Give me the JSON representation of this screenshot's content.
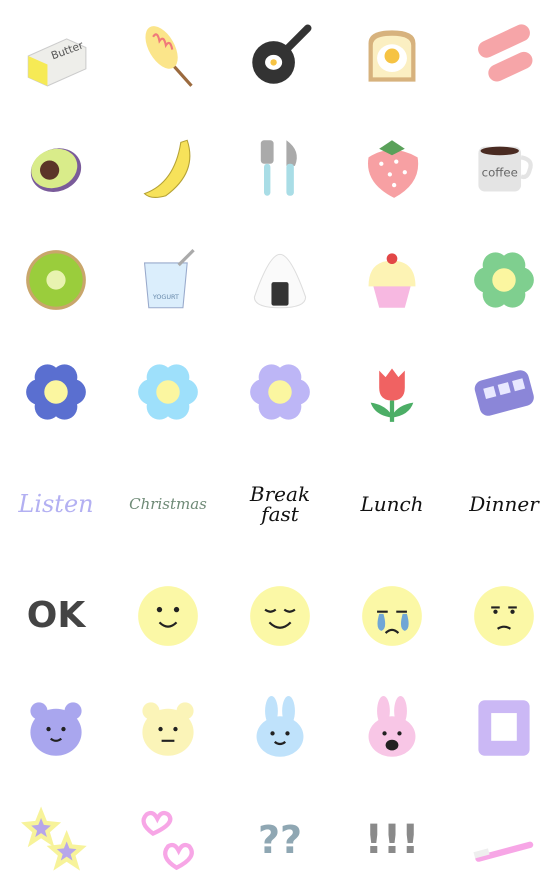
{
  "stickers": [
    {
      "name": "butter",
      "label": "Butter"
    },
    {
      "name": "corn-dog"
    },
    {
      "name": "frying-pan-egg"
    },
    {
      "name": "egg-toast"
    },
    {
      "name": "sausages"
    },
    {
      "name": "avocado"
    },
    {
      "name": "banana"
    },
    {
      "name": "fork-knife"
    },
    {
      "name": "strawberry"
    },
    {
      "name": "coffee-cup",
      "label": "coffee"
    },
    {
      "name": "kiwi"
    },
    {
      "name": "yogurt",
      "label": "YOGURT"
    },
    {
      "name": "onigiri"
    },
    {
      "name": "cupcake"
    },
    {
      "name": "green-flower",
      "color": "#7fcf8f"
    },
    {
      "name": "blue-flower",
      "color": "#5a6fd0"
    },
    {
      "name": "light-blue-flower",
      "color": "#9ee0fb"
    },
    {
      "name": "lavender-flower",
      "color": "#bdb6f6"
    },
    {
      "name": "tulip"
    },
    {
      "name": "train"
    },
    {
      "name": "word-listen",
      "text": "Listen",
      "color": "#b3b0f2"
    },
    {
      "name": "word-christmas",
      "text": "Christmas",
      "color": "#6e8a76"
    },
    {
      "name": "word-breakfast",
      "text": "Break\nfast",
      "color": "#111111"
    },
    {
      "name": "word-lunch",
      "text": "Lunch",
      "color": "#111111"
    },
    {
      "name": "word-dinner",
      "text": "Dinner",
      "color": "#111111"
    },
    {
      "name": "word-ok",
      "text": "OK",
      "color": "#444444"
    },
    {
      "name": "smile-face"
    },
    {
      "name": "content-face"
    },
    {
      "name": "crying-face"
    },
    {
      "name": "meh-face"
    },
    {
      "name": "purple-bear"
    },
    {
      "name": "yellow-bear"
    },
    {
      "name": "blue-bunny"
    },
    {
      "name": "pink-bunny-shocked"
    },
    {
      "name": "purple-square-frame"
    },
    {
      "name": "stars"
    },
    {
      "name": "hearts"
    },
    {
      "name": "question-marks",
      "text": "??",
      "color": "#8fa7b3"
    },
    {
      "name": "exclamation-marks",
      "text": "!!!",
      "color": "#8a8a8a"
    },
    {
      "name": "toothbrush"
    }
  ]
}
